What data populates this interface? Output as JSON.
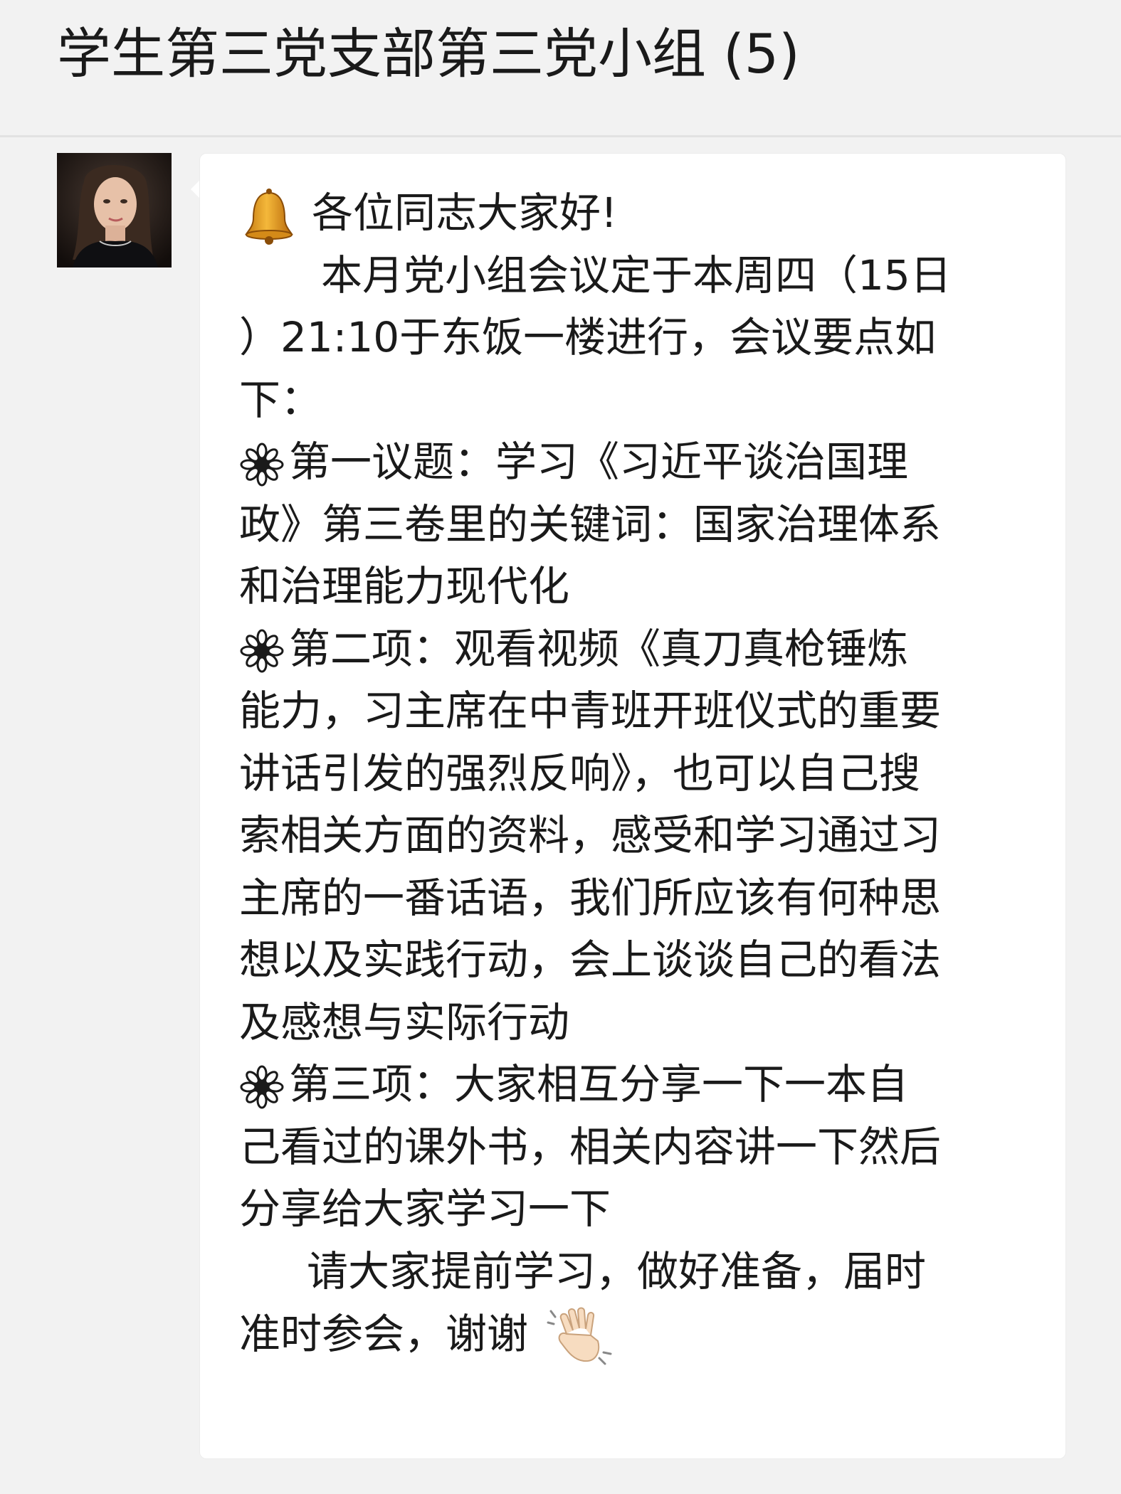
{
  "chat": {
    "title": "学生第三党支部第三党小组 (5)"
  },
  "message": {
    "greeting": "各位同志大家好!",
    "lines": [
      "本月党小组会议定于本周四（15日",
      "）21:10于东饭一楼进行，会议要点如",
      "下：",
      "第一议题：学习《习近平谈治国理",
      "政》第三卷里的关键词：国家治理体系",
      "和治理能力现代化",
      "第二项：观看视频《真刀真枪锤炼",
      "能力，习主席在中青班开班仪式的重要",
      "讲话引发的强烈反响》，也可以自己搜",
      "索相关方面的资料，感受和学习通过习",
      "主席的一番话语，我们所应该有何种思",
      "想以及实践行动，会上谈谈自己的看法",
      "及感想与实际行动",
      "第三项：大家相互分享一下一本自",
      "己看过的课外书，相关内容讲一下然后",
      "分享给大家学习一下",
      "请大家提前学习，做好准备，届时",
      "准时参会，谢谢"
    ]
  },
  "icons": {
    "bell": "bell-emoji",
    "flower": "flower-bullet",
    "wave": "waving-hand-emoji"
  }
}
